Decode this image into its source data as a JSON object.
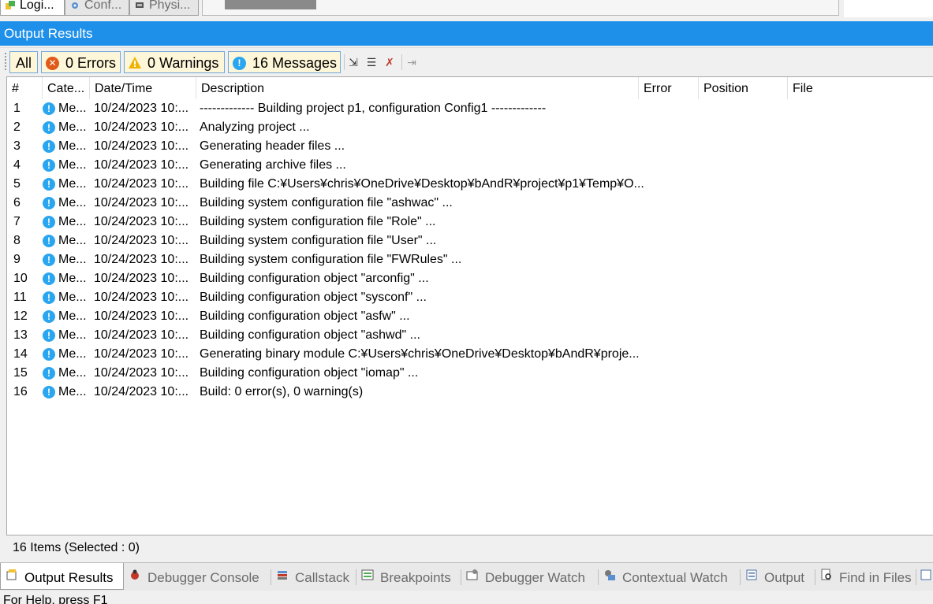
{
  "top_tabs": [
    {
      "label": "Logi...",
      "icon": "logical-view-icon"
    },
    {
      "label": "Conf...",
      "icon": "configuration-view-icon"
    },
    {
      "label": "Physi...",
      "icon": "physical-view-icon"
    }
  ],
  "panel_title": "Output Results",
  "filters": {
    "all": "All",
    "errors": "0 Errors",
    "warnings": "0 Warnings",
    "messages": "16 Messages"
  },
  "columns": [
    "#",
    "Cate...",
    "Date/Time",
    "Description",
    "Error",
    "Position",
    "File"
  ],
  "rows": [
    {
      "num": "1",
      "category": "Me...",
      "datetime": "10/24/2023 10:...",
      "description": "------------- Building project p1, configuration Config1 -------------"
    },
    {
      "num": "2",
      "category": "Me...",
      "datetime": "10/24/2023 10:...",
      "description": "Analyzing project ..."
    },
    {
      "num": "3",
      "category": "Me...",
      "datetime": "10/24/2023 10:...",
      "description": "Generating header files ..."
    },
    {
      "num": "4",
      "category": "Me...",
      "datetime": "10/24/2023 10:...",
      "description": "Generating archive files ..."
    },
    {
      "num": "5",
      "category": "Me...",
      "datetime": "10/24/2023 10:...",
      "description": "Building file C:¥Users¥chris¥OneDrive¥Desktop¥bAndR¥project¥p1¥Temp¥O..."
    },
    {
      "num": "6",
      "category": "Me...",
      "datetime": "10/24/2023 10:...",
      "description": "Building system configuration file \"ashwac\" ..."
    },
    {
      "num": "7",
      "category": "Me...",
      "datetime": "10/24/2023 10:...",
      "description": "Building system configuration file \"Role\" ..."
    },
    {
      "num": "8",
      "category": "Me...",
      "datetime": "10/24/2023 10:...",
      "description": "Building system configuration file \"User\" ..."
    },
    {
      "num": "9",
      "category": "Me...",
      "datetime": "10/24/2023 10:...",
      "description": "Building system configuration file \"FWRules\" ..."
    },
    {
      "num": "10",
      "category": "Me...",
      "datetime": "10/24/2023 10:...",
      "description": "Building configuration object \"arconfig\" ..."
    },
    {
      "num": "11",
      "category": "Me...",
      "datetime": "10/24/2023 10:...",
      "description": "Building configuration object \"sysconf\" ..."
    },
    {
      "num": "12",
      "category": "Me...",
      "datetime": "10/24/2023 10:...",
      "description": "Building configuration object \"asfw\" ..."
    },
    {
      "num": "13",
      "category": "Me...",
      "datetime": "10/24/2023 10:...",
      "description": "Building configuration object \"ashwd\" ..."
    },
    {
      "num": "14",
      "category": "Me...",
      "datetime": "10/24/2023 10:...",
      "description": "Generating binary module C:¥Users¥chris¥OneDrive¥Desktop¥bAndR¥proje..."
    },
    {
      "num": "15",
      "category": "Me...",
      "datetime": "10/24/2023 10:...",
      "description": "Building configuration object \"iomap\" ..."
    },
    {
      "num": "16",
      "category": "Me...",
      "datetime": "10/24/2023 10:...",
      "description": "Build: 0 error(s), 0 warning(s)"
    }
  ],
  "status_text": "16 Items (Selected : 0)",
  "bottom_tabs": [
    {
      "label": "Output Results",
      "icon": "output-results-icon"
    },
    {
      "label": "Debugger Console",
      "icon": "debugger-console-icon"
    },
    {
      "label": "Callstack",
      "icon": "callstack-icon"
    },
    {
      "label": "Breakpoints",
      "icon": "breakpoints-icon"
    },
    {
      "label": "Debugger Watch",
      "icon": "debugger-watch-icon"
    },
    {
      "label": "Contextual Watch",
      "icon": "contextual-watch-icon"
    },
    {
      "label": "Output",
      "icon": "output-icon"
    },
    {
      "label": "Find in Files",
      "icon": "find-in-files-icon"
    }
  ],
  "help_text": "For Help, press F1",
  "colors": {
    "title_bar": "#1e90ea",
    "filter_button_bg": "#fdf6d8",
    "filter_button_border": "#6fa8dc",
    "error_icon": "#e05a1a",
    "warning_icon": "#f0b400",
    "message_icon": "#2aa6f0"
  }
}
